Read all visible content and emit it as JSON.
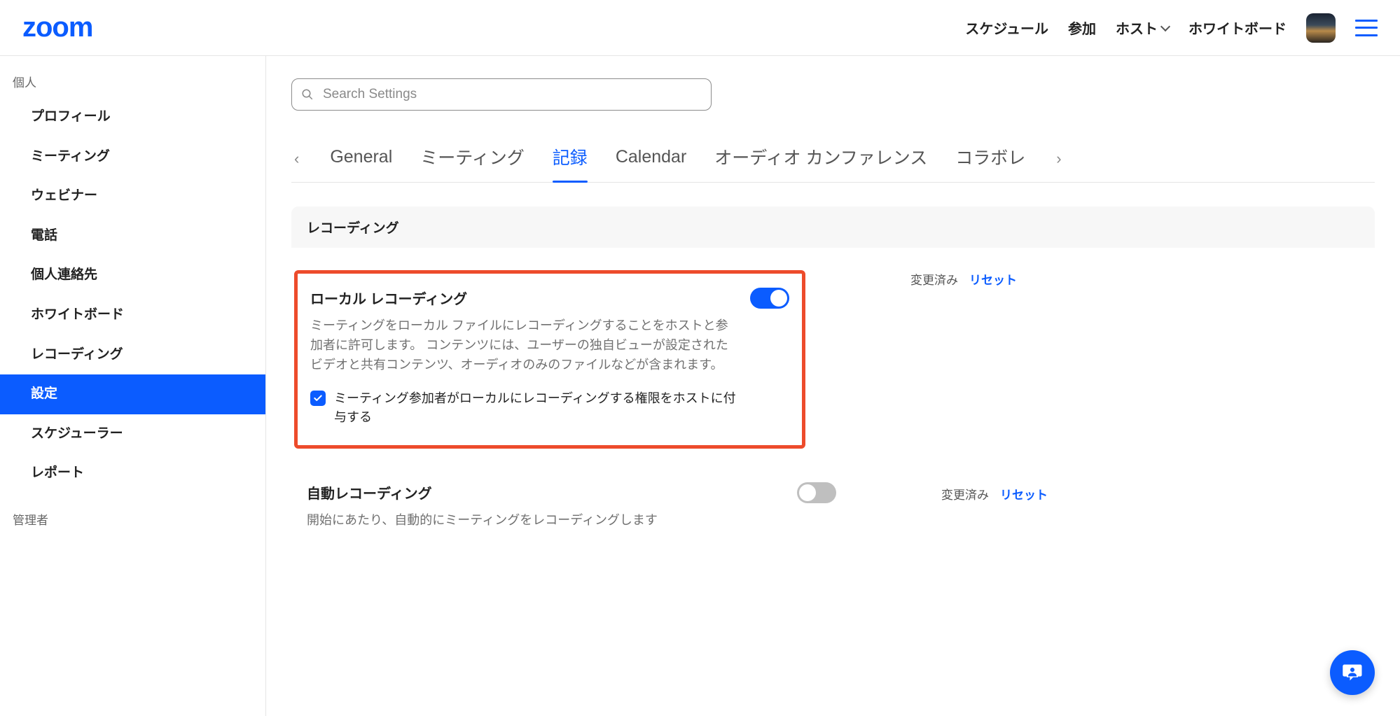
{
  "brand": "zoom",
  "header": {
    "links": {
      "schedule": "スケジュール",
      "join": "参加",
      "host": "ホスト",
      "whiteboard": "ホワイトボード"
    }
  },
  "sidebar": {
    "section_personal": "個人",
    "items": {
      "profile": "プロフィール",
      "meetings": "ミーティング",
      "webinars": "ウェビナー",
      "phone": "電話",
      "contacts": "個人連絡先",
      "whiteboard": "ホワイトボード",
      "recordings": "レコーディング",
      "settings": "設定",
      "scheduler": "スケジューラー",
      "reports": "レポート"
    },
    "section_admin": "管理者"
  },
  "search": {
    "placeholder": "Search Settings"
  },
  "tabs": {
    "general": "General",
    "meeting": "ミーティング",
    "recording": "記録",
    "calendar": "Calendar",
    "audio": "オーディオ カンファレンス",
    "collab": "コラボレ"
  },
  "section": {
    "recording_header": "レコーディング"
  },
  "local_recording": {
    "title": "ローカル レコーディング",
    "desc": "ミーティングをローカル ファイルにレコーディングすることをホストと参加者に許可します。 コンテンツには、ユーザーの独自ビューが設定されたビデオと共有コンテンツ、オーディオのみのファイルなどが含まれます。",
    "sub_option": "ミーティング参加者がローカルにレコーディングする権限をホストに付与する",
    "status": "変更済み",
    "reset": "リセット"
  },
  "auto_recording": {
    "title": "自動レコーディング",
    "desc": "開始にあたり、自動的にミーティングをレコーディングします",
    "status": "変更済み",
    "reset": "リセット"
  }
}
